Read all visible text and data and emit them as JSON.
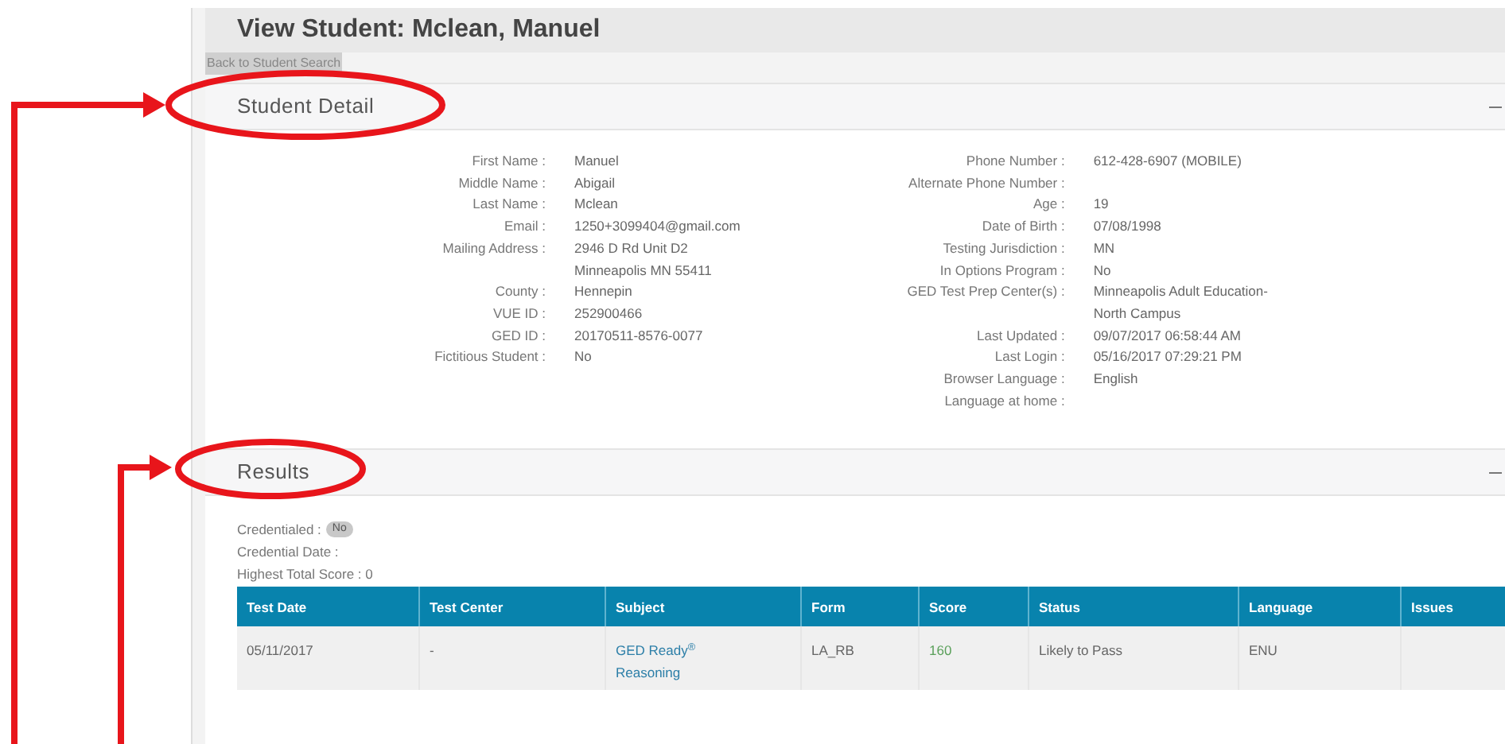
{
  "page_title": "View Student: Mclean, Manuel",
  "back_button": "Back to Student Search",
  "student_detail": {
    "title": "Student Detail",
    "left_fields": [
      {
        "label": "First Name :",
        "value": [
          "Manuel"
        ]
      },
      {
        "label": "Middle Name :",
        "value": [
          "Abigail"
        ]
      },
      {
        "label": "Last Name :",
        "value": [
          "Mclean"
        ]
      },
      {
        "label": "Email :",
        "value": [
          "1250+3099404@gmail.com"
        ]
      },
      {
        "label": "Mailing Address :",
        "value": [
          "2946 D Rd Unit D2",
          "Minneapolis MN 55411"
        ]
      },
      {
        "label": "County :",
        "value": [
          "Hennepin"
        ]
      },
      {
        "label": "VUE ID :",
        "value": [
          "252900466"
        ]
      },
      {
        "label": "GED ID :",
        "value": [
          "20170511-8576-0077"
        ]
      },
      {
        "label": "Fictitious Student :",
        "value": [
          "No"
        ]
      }
    ],
    "right_fields": [
      {
        "label": "Phone Number :",
        "value": [
          "612-428-6907 (MOBILE)"
        ]
      },
      {
        "label": "Alternate Phone Number :"
      },
      {
        "label": "Age :",
        "value": [
          "19"
        ]
      },
      {
        "label": "Date of Birth :",
        "value": [
          "07/08/1998"
        ]
      },
      {
        "label": "Testing Jurisdiction :",
        "value": [
          "MN"
        ]
      },
      {
        "label": "In Options Program :",
        "value": [
          "No"
        ]
      },
      {
        "label": "GED Test Prep Center(s) :",
        "value": [
          "Minneapolis Adult Education-",
          "North Campus"
        ]
      },
      {
        "label": "Last Updated :",
        "value": [
          "09/07/2017 06:58:44 AM"
        ]
      },
      {
        "label": "Last Login :",
        "value": [
          "05/16/2017 07:29:21 PM"
        ]
      },
      {
        "label": "Browser Language :",
        "value": [
          "English"
        ]
      },
      {
        "label": "Language at home :"
      }
    ]
  },
  "results": {
    "title": "Results",
    "credentialed_label": "Credentialed :",
    "credentialed_badge": "No",
    "credential_date_label": "Credential Date :",
    "highest_total_score": "Highest Total Score : 0",
    "table": {
      "columns": [
        "Test Date",
        "Test Center",
        "Subject",
        "Form",
        "Score",
        "Status",
        "Language",
        "Issues"
      ],
      "rows": [
        [
          {
            "kind": "plain",
            "text": "05/11/2017"
          },
          {
            "kind": "plain",
            "text": "-"
          },
          {
            "kind": "link",
            "text": "GED Ready$^{®}$ Reasoning"
          },
          {
            "kind": "plain",
            "text": "LA_RB"
          },
          {
            "kind": "score",
            "text": "160"
          },
          {
            "kind": "plain",
            "text": "Likely to Pass"
          },
          {
            "kind": "plain",
            "text": "ENU"
          }
        ]
      ]
    }
  }
}
